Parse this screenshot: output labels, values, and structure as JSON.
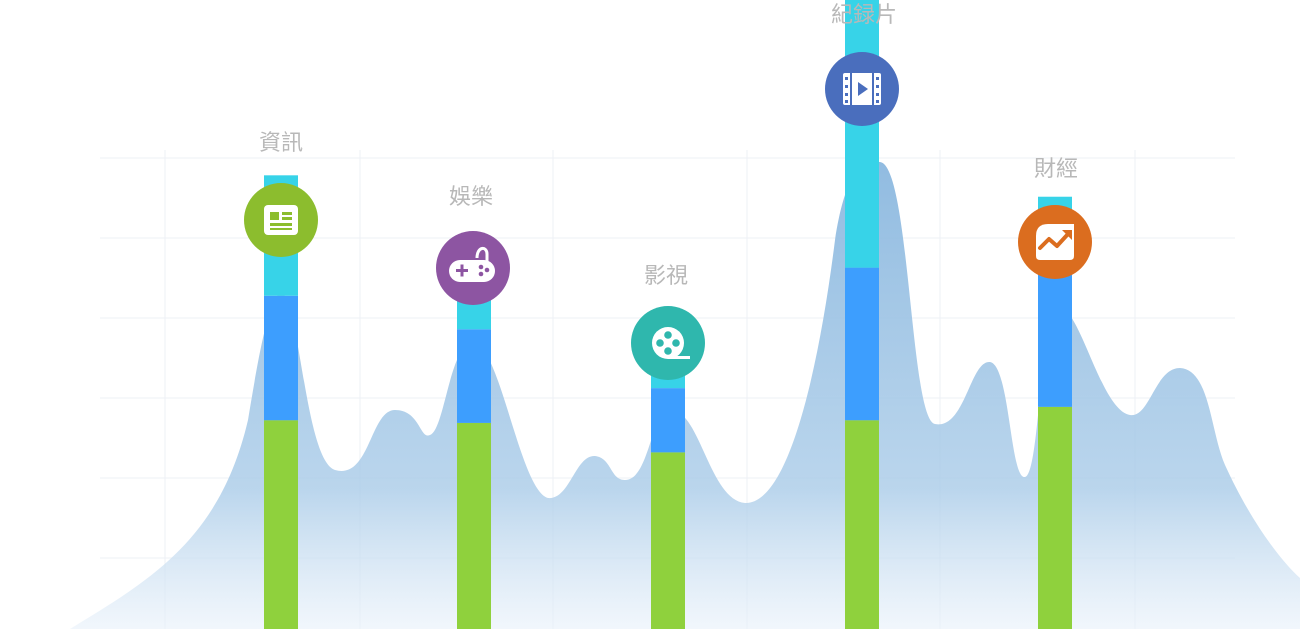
{
  "chart_data": {
    "type": "bar",
    "stacked": true,
    "categories": [
      "資訊",
      "娛樂",
      "影視",
      "紀録片",
      "財經"
    ],
    "series": [
      {
        "values": [
          156,
          154,
          132,
          156,
          166
        ]
      },
      {
        "values": [
          93,
          70,
          48,
          114,
          129
        ]
      },
      {
        "values": [
          90,
          63,
          38,
          201,
          28
        ]
      }
    ],
    "ylim": [
      0,
      470
    ],
    "grid": true,
    "legend": "none",
    "icons": [
      "news-icon",
      "gamepad-icon",
      "film-reel-icon",
      "video-icon",
      "trend-chart-icon"
    ],
    "icon_colors": [
      "#8cbd2e",
      "#8d55a2",
      "#2fb7ad",
      "#4a6ebd",
      "#db6d1f"
    ],
    "series_colors": [
      "#8fd13d",
      "#3d9efe",
      "#37d3e8"
    ],
    "area_color": "#8bb8df"
  }
}
